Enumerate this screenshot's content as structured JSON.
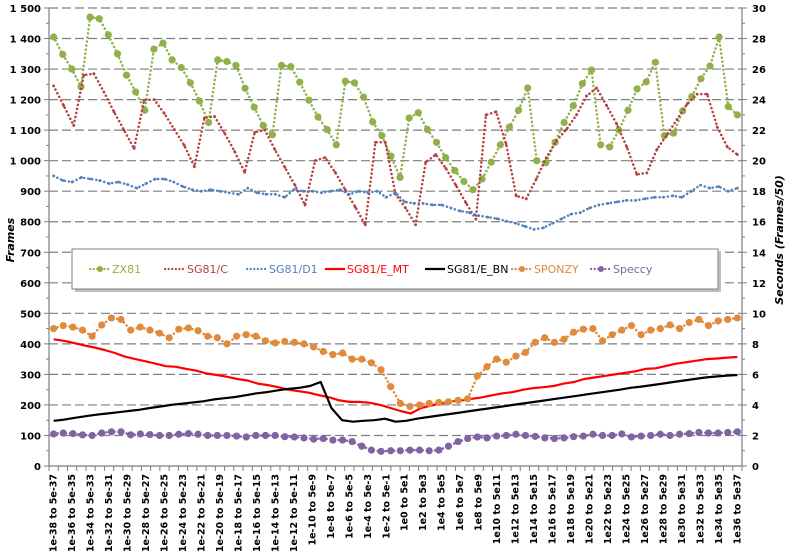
{
  "chart_data": {
    "type": "line",
    "title": "",
    "xlabel": "",
    "ylabel": "Frames",
    "ylabel_right": "Seconds (Frames/50)",
    "ylim": [
      0,
      1500
    ],
    "ylim_right": [
      0,
      30
    ],
    "y_ticks": [
      "0",
      "100",
      "200",
      "300",
      "400",
      "500",
      "600",
      "700",
      "800",
      "900",
      "1 000",
      "1 100",
      "1 200",
      "1 300",
      "1 400",
      "1 500"
    ],
    "y_ticks_right": [
      "0",
      "2",
      "4",
      "6",
      "8",
      "10",
      "12",
      "14",
      "16",
      "18",
      "20",
      "22",
      "24",
      "26",
      "28",
      "30"
    ],
    "grid": true,
    "legend_position": "middle",
    "x_tick_labels": [
      "1e-38 to 5e-37",
      "1e-36 to 5e-35",
      "1e-34 to 5e-33",
      "1e-32 to 5e-31",
      "1e-30 to 5e-29",
      "1e-28 to 5e-27",
      "1e-26 to 5e-25",
      "1e-24 to 5e-23",
      "1e-22 to 5e-21",
      "1e-20 to 5e-19",
      "1e-18 to 5e-17",
      "1e-16 to 5e-15",
      "1e-14 to 5e-13",
      "1e-12 to 5e-11",
      "1e-10 to 5e-9",
      "1e-8 to 5e-7",
      "1e-6 to 5e-5",
      "1e-4 to 5e-3",
      "1e-2 to 5e-1",
      "1e0 to 5e1",
      "1e2 to 5e3",
      "1e4 to 5e5",
      "1e6 to 5e7",
      "1e8 to 5e9",
      "1e10 to 5e11",
      "1e12 to 5e13",
      "1e14 to 5e15",
      "1e16 to 5e17",
      "1e18 to 5e19",
      "1e20 to 5e21",
      "1e22 to 5e23",
      "1e24 to 5e25",
      "1e26 to 5e27",
      "1e28 to 5e29",
      "1e30 to 5e31",
      "1e32 to 5e33",
      "1e34 to 5e35",
      "1e36 to 5e37"
    ],
    "num_points": 75,
    "series": [
      {
        "name": "ZX81",
        "color": "#8fb04a",
        "style": "dotted-marker",
        "axis": "left",
        "values": [
          1405,
          1348,
          1300,
          1242,
          1470,
          1465,
          1412,
          1350,
          1280,
          1225,
          1165,
          1365,
          1385,
          1330,
          1305,
          1255,
          1195,
          1125,
          1330,
          1325,
          1312,
          1237,
          1175,
          1115,
          1085,
          1312,
          1308,
          1257,
          1198,
          1143,
          1102,
          1052,
          1260,
          1255,
          1208,
          1127,
          1082,
          1015,
          945,
          1140,
          1157,
          1102,
          1060,
          1010,
          968,
          932,
          905,
          940,
          995,
          1052,
          1110,
          1165,
          1238,
          1000,
          993,
          1060,
          1125,
          1180,
          1252,
          1297,
          1052,
          1045,
          1100,
          1165,
          1235,
          1258,
          1322,
          1082,
          1090,
          1163,
          1210,
          1268,
          1310,
          1405,
          1177,
          1150
        ]
      },
      {
        "name": "SG81/C",
        "color": "#b5403e",
        "style": "dotted",
        "axis": "left",
        "values": [
          1245,
          1180,
          1115,
          1280,
          1285,
          1225,
          1160,
          1100,
          1040,
          1198,
          1200,
          1155,
          1102,
          1050,
          980,
          1140,
          1145,
          1090,
          1030,
          962,
          1093,
          1100,
          1037,
          978,
          920,
          855,
          1000,
          1010,
          962,
          905,
          848,
          790,
          1060,
          1060,
          890,
          845,
          790,
          995,
          1020,
          975,
          920,
          862,
          808,
          1150,
          1160,
          1055,
          885,
          875,
          940,
          1010,
          1065,
          1102,
          1150,
          1212,
          1238,
          1180,
          1120,
          1045,
          955,
          960,
          1037,
          1085,
          1135,
          1185,
          1218,
          1218,
          1110,
          1045,
          1020
        ]
      },
      {
        "name": "SG81/D1",
        "color": "#4f81bd",
        "style": "dotted",
        "axis": "left",
        "values": [
          950,
          935,
          930,
          945,
          940,
          935,
          925,
          930,
          922,
          910,
          925,
          940,
          940,
          930,
          915,
          905,
          900,
          905,
          900,
          895,
          890,
          910,
          895,
          890,
          890,
          880,
          905,
          900,
          900,
          895,
          900,
          905,
          890,
          900,
          895,
          900,
          880,
          895,
          865,
          860,
          860,
          855,
          855,
          845,
          835,
          830,
          820,
          815,
          810,
          802,
          795,
          785,
          775,
          780,
          795,
          810,
          825,
          830,
          845,
          855,
          860,
          865,
          870,
          870,
          875,
          880,
          880,
          885,
          880,
          900,
          920,
          910,
          915,
          900,
          910
        ]
      },
      {
        "name": "SG81/E_MT",
        "color": "#ff0000",
        "style": "solid",
        "axis": "left",
        "values": [
          415,
          410,
          403,
          395,
          388,
          380,
          370,
          358,
          350,
          343,
          335,
          327,
          325,
          318,
          312,
          303,
          298,
          292,
          285,
          280,
          270,
          265,
          258,
          250,
          245,
          240,
          232,
          225,
          215,
          210,
          210,
          207,
          200,
          190,
          180,
          172,
          190,
          198,
          205,
          212,
          215,
          220,
          225,
          232,
          238,
          242,
          250,
          255,
          258,
          262,
          270,
          275,
          285,
          290,
          295,
          300,
          305,
          310,
          318,
          320,
          328,
          335,
          340,
          345,
          350,
          352,
          355,
          357
        ]
      },
      {
        "name": "SG81/E_BN",
        "color": "#000000",
        "style": "solid",
        "axis": "left",
        "values": [
          148,
          152,
          158,
          163,
          168,
          172,
          176,
          180,
          184,
          190,
          195,
          200,
          204,
          208,
          212,
          218,
          222,
          226,
          232,
          238,
          242,
          248,
          253,
          256,
          262,
          275,
          190,
          150,
          145,
          148,
          150,
          155,
          145,
          148,
          155,
          160,
          165,
          170,
          175,
          180,
          185,
          190,
          195,
          200,
          205,
          210,
          215,
          220,
          225,
          230,
          235,
          240,
          245,
          250,
          256,
          260,
          265,
          270,
          275,
          280,
          285,
          290,
          293,
          296,
          298
        ]
      },
      {
        "name": "SPONZY",
        "color": "#e08a3c",
        "style": "dotted-marker",
        "axis": "left",
        "values": [
          450,
          460,
          455,
          445,
          425,
          462,
          485,
          480,
          445,
          455,
          445,
          435,
          420,
          448,
          452,
          443,
          425,
          420,
          400,
          425,
          430,
          425,
          410,
          403,
          408,
          405,
          400,
          390,
          375,
          365,
          370,
          350,
          350,
          338,
          315,
          260,
          205,
          195,
          200,
          205,
          208,
          210,
          215,
          220,
          295,
          325,
          350,
          340,
          360,
          372,
          405,
          420,
          405,
          415,
          438,
          448,
          450,
          410,
          430,
          445,
          460,
          430,
          445,
          450,
          462,
          450,
          470,
          480,
          460,
          475,
          480,
          485
        ]
      },
      {
        "name": "Speccy",
        "color": "#8064a2",
        "style": "dotted-marker",
        "axis": "left",
        "values": [
          105,
          108,
          106,
          102,
          100,
          108,
          112,
          112,
          102,
          105,
          103,
          100,
          100,
          104,
          106,
          104,
          100,
          100,
          100,
          98,
          95,
          100,
          100,
          100,
          96,
          95,
          92,
          88,
          90,
          85,
          85,
          80,
          65,
          52,
          48,
          50,
          50,
          52,
          52,
          50,
          52,
          65,
          80,
          90,
          95,
          92,
          98,
          100,
          104,
          100,
          97,
          92,
          90,
          92,
          96,
          98,
          104,
          100,
          100,
          105,
          95,
          98,
          100,
          104,
          100,
          104,
          106,
          110,
          108,
          108,
          110,
          112
        ]
      }
    ]
  },
  "legend": {
    "items": [
      "ZX81",
      "SG81/C",
      "SG81/D1",
      "SG81/E_MT",
      "SG81/E_BN",
      "SPONZY",
      "Speccy"
    ]
  }
}
